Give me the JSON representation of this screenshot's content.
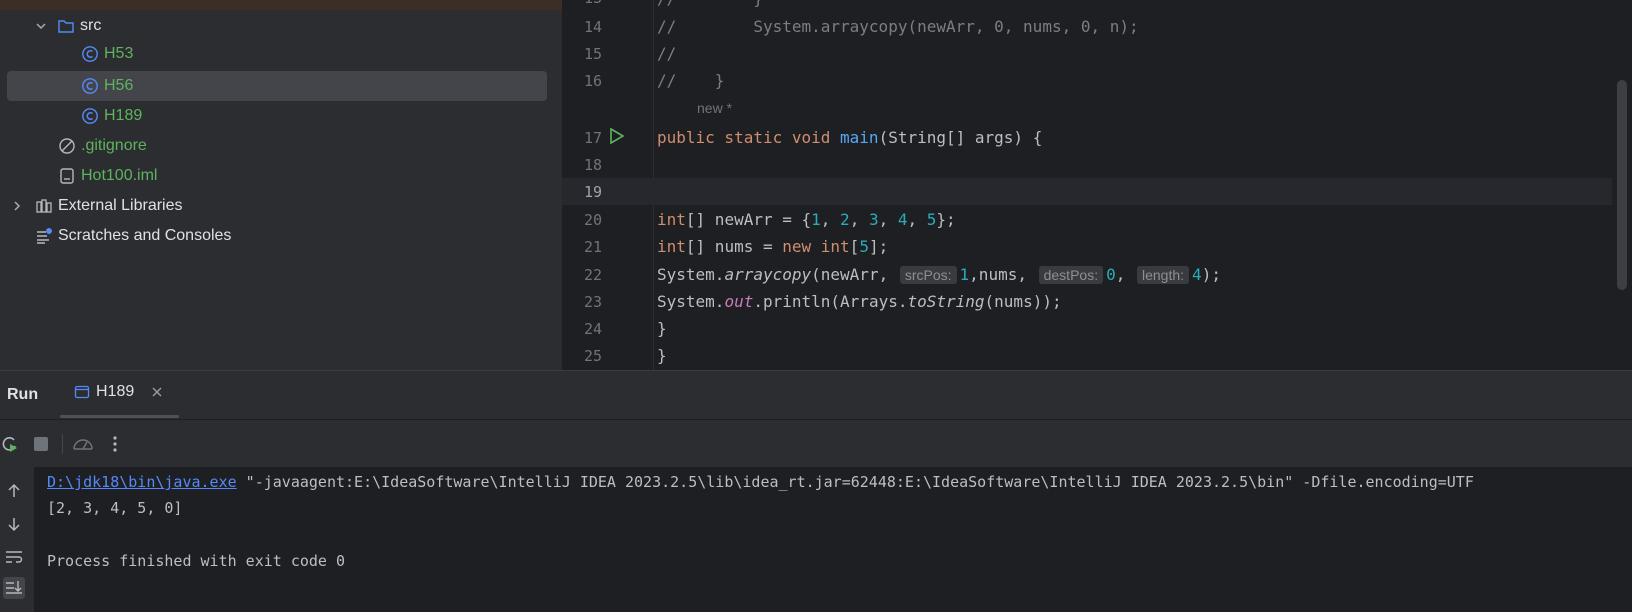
{
  "project_tree": {
    "items": [
      {
        "label": "src",
        "type": "folder"
      },
      {
        "label": "H53",
        "type": "class"
      },
      {
        "label": "H56",
        "type": "class",
        "selected": true
      },
      {
        "label": "H189",
        "type": "class"
      },
      {
        "label": ".gitignore",
        "type": "ignore-file"
      },
      {
        "label": "Hot100.iml",
        "type": "module-file"
      },
      {
        "label": "External Libraries",
        "type": "libraries"
      },
      {
        "label": "Scratches and Consoles",
        "type": "scratches"
      }
    ]
  },
  "editor": {
    "author_hint": "new *",
    "lines": [
      {
        "n": "14",
        "text": "//        System.arraycopy(newArr, 0, nums, 0, n);"
      },
      {
        "n": "15",
        "text": "//"
      },
      {
        "n": "16",
        "text": "//    }"
      },
      {
        "n": "17",
        "kw1": "public static void ",
        "fn": "main",
        "rest": "(String[] args) {"
      },
      {
        "n": "18"
      },
      {
        "n": "19"
      },
      {
        "n": "20",
        "kw": "int",
        "a": "[] newArr = {",
        "v1": "1",
        "v2": "2",
        "v3": "3",
        "v4": "4",
        "v5": "5",
        "b": "};"
      },
      {
        "n": "21",
        "kw": "int",
        "a": "[] nums = ",
        "kw2": "new ",
        "kw3": "int",
        "b": "[",
        "v": "5",
        "c": "];"
      },
      {
        "n": "22",
        "a": "System.",
        "m": "arraycopy",
        "b": "(newArr, ",
        "h1": "srcPos:",
        "v1": "1",
        "c": ",nums, ",
        "h2": "destPos:",
        "v2": "0",
        "d": ", ",
        "h3": "length:",
        "v3": "4",
        "e": ");"
      },
      {
        "n": "23",
        "a": "System.",
        "f": "out",
        "b": ".println(Arrays.",
        "m": "toString",
        "c": "(nums));"
      },
      {
        "n": "24",
        "text": "}"
      },
      {
        "n": "25",
        "text": "}"
      }
    ]
  },
  "run_panel": {
    "title": "Run",
    "tab_label": "H189",
    "console": {
      "java_path": "D:\\jdk18\\bin\\java.exe",
      "command_args": " \"-javaagent:E:\\IdeaSoftware\\IntelliJ IDEA 2023.2.5\\lib\\idea_rt.jar=62448:E:\\IdeaSoftware\\IntelliJ IDEA 2023.2.5\\bin\" -Dfile.encoding=UTF",
      "output": "[2, 3, 4, 5, 0]",
      "exit_message": "Process finished with exit code 0"
    }
  }
}
